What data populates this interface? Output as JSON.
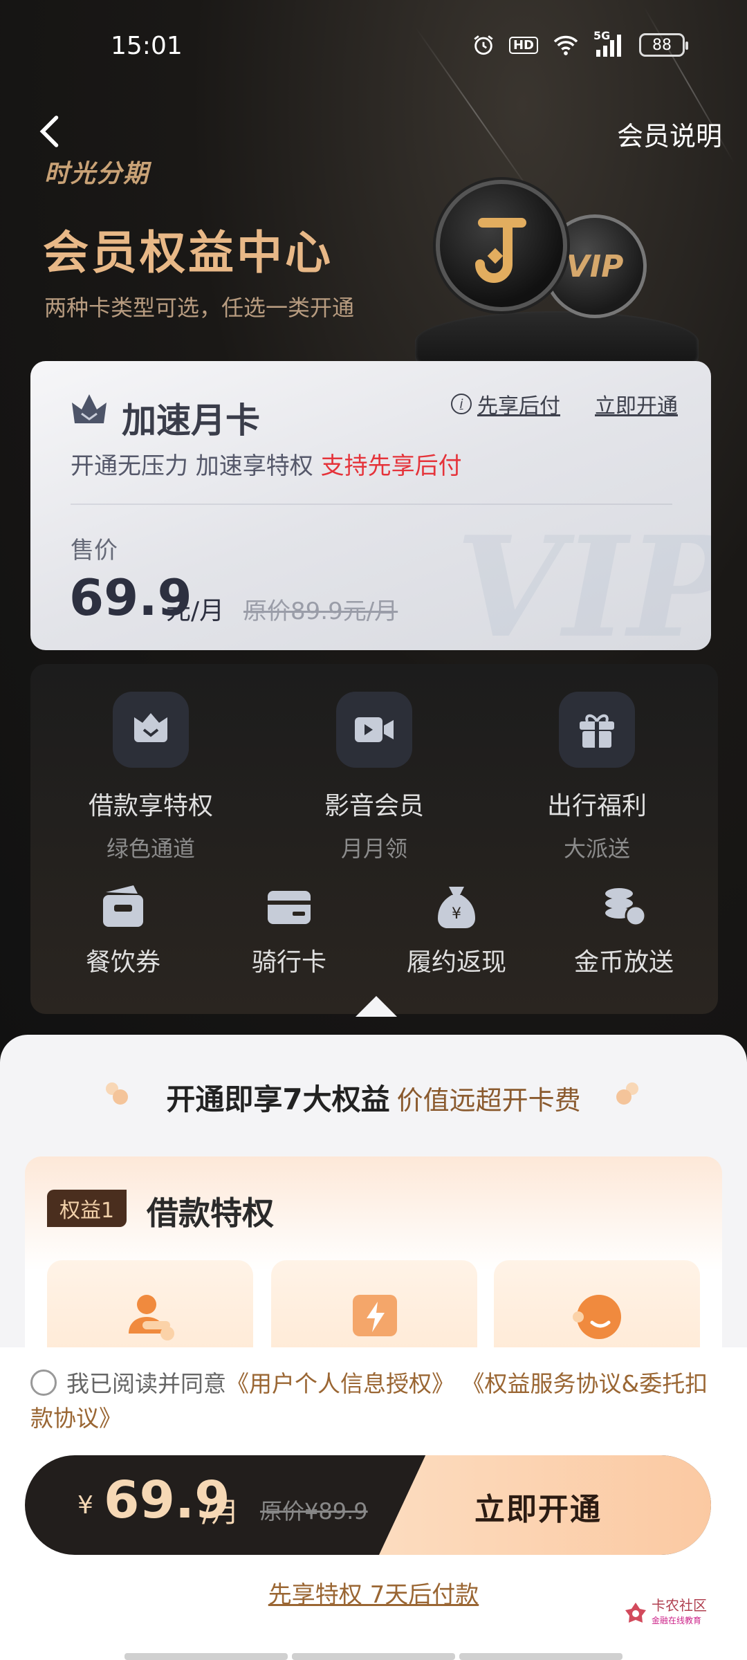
{
  "status_bar": {
    "time": "15:01",
    "hd": "HD",
    "network": "5G",
    "battery": "88"
  },
  "header": {
    "member_info": "会员说明",
    "brand": "时光分期",
    "title": "会员权益中心",
    "subtitle": "两种卡类型可选，任选一类开通",
    "coin_vip": "VIP"
  },
  "card": {
    "title": "加速月卡",
    "first_enjoy": "先享后付",
    "open_now": "立即开通",
    "desc_main": "开通无压力 加速享特权 ",
    "desc_highlight": "支持先享后付",
    "price_label": "售价",
    "price": "69.9",
    "price_unit": "元/月",
    "original_price": "原价89.9元/月",
    "watermark": "VIP"
  },
  "benefits": {
    "big": [
      {
        "title": "借款享特权",
        "sub": "绿色通道",
        "icon": "crown-shield-icon"
      },
      {
        "title": "影音会员",
        "sub": "月月领",
        "icon": "video-camera-icon"
      },
      {
        "title": "出行福利",
        "sub": "大派送",
        "icon": "gift-icon"
      }
    ],
    "small": [
      {
        "title": "餐饮券",
        "icon": "food-coupon-icon"
      },
      {
        "title": "骑行卡",
        "icon": "riding-card-icon"
      },
      {
        "title": "履约返现",
        "icon": "money-bag-icon"
      },
      {
        "title": "金币放送",
        "icon": "coins-icon"
      }
    ]
  },
  "promo": {
    "main": "开通即享7大权益",
    "sub": "价值远超开卡费"
  },
  "rights": {
    "tag": "权益1",
    "title": "借款特权"
  },
  "agreement": {
    "prefix": "我已阅读并同意",
    "link1": "《用户个人信息授权》",
    "link2": "《权益服务协议&委托扣款协议》"
  },
  "buy_bar": {
    "currency": "¥",
    "price": "69.9",
    "unit": "/月",
    "original": "原价¥89.9",
    "button": "立即开通"
  },
  "later_link": "先享特权 7天后付款",
  "watermark": {
    "title": "卡农社区",
    "sub": "金融在线教育"
  },
  "colors": {
    "gold": "#e8b887",
    "highlight_red": "#e5333a",
    "link_brown": "#9a6633"
  }
}
